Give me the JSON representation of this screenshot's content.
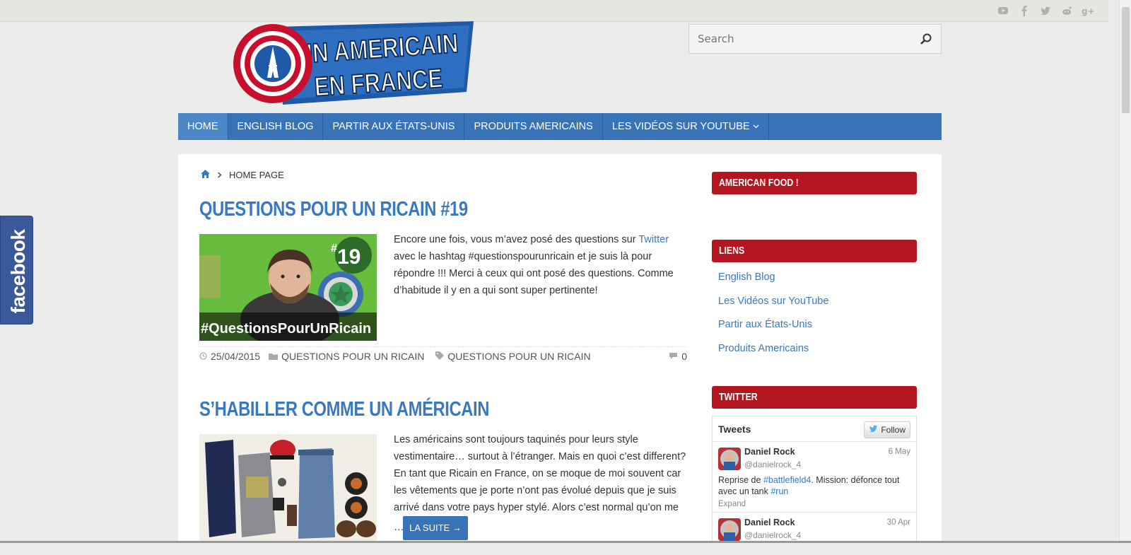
{
  "social": {
    "icons": [
      "youtube-icon",
      "facebook-icon",
      "twitter-icon",
      "reddit-icon",
      "google-plus-icon"
    ]
  },
  "logo": {
    "line1": "UN AMERICAIN",
    "line2": "EN FRANCE"
  },
  "search": {
    "placeholder": "Search"
  },
  "nav": {
    "items": [
      {
        "label": "HOME"
      },
      {
        "label": "ENGLISH BLOG"
      },
      {
        "label": "PARTIR AUX ÉTATS-UNIS"
      },
      {
        "label": "PRODUITS AMERICAINS"
      },
      {
        "label": "LES VIDÉOS SUR YOUTUBE"
      }
    ]
  },
  "breadcrumb": {
    "current": "HOME PAGE"
  },
  "posts": [
    {
      "title": "QUESTIONS POUR UN RICAIN #19",
      "thumb_badge_hash": "#",
      "thumb_badge_num": "19",
      "thumb_caption": "#QuestionsPourUnRicain",
      "text_before_link": "Encore une fois, vous m’avez posé des questions sur ",
      "link": "Twitter",
      "text_after_link": " avec le hashtag #questionspourunricain et je suis là pour répondre !!! Merci à ceux qui ont posé des questions. Comme d’habitude il y en a qui sont super pertinente!",
      "date": "25/04/2015",
      "category": "QUESTIONS POUR UN RICAIN",
      "tag": "QUESTIONS POUR UN RICAIN",
      "comments": "0"
    },
    {
      "title": "S’HABILLER COMME UN AMÉRICAIN",
      "text": "Les américains sont toujours taquinés pour leurs style vestimentaire… surtout à l’étranger. Mais en quoi c’est different? En tant que Ricain en France, on se moque de moi souvent car les vêtements que je porte n’ont pas évolué depuis que je suis arrivé dans votre pays hyper stylé. Alors c’est normal qu’on me",
      "ellipsis": "…",
      "readmore": "LA SUITE →"
    }
  ],
  "sidebar": {
    "widget1": {
      "title": "AMERICAN FOOD !"
    },
    "widget2": {
      "title": "LIENS",
      "links": [
        "English Blog",
        "Les Vidéos sur YouTube",
        "Partir aux États-Unis",
        "Produits Americains"
      ]
    },
    "widget3": {
      "title": "TWITTER",
      "header": "Tweets",
      "follow": "Follow",
      "tweets": [
        {
          "name": "Daniel Rock",
          "handle": "@danielrock_4",
          "date": "6 May",
          "text_a": "Reprise de ",
          "tag1": "#battlefield4",
          "text_b": ". Mission: défonce tout avec un tank ",
          "tag2": "#run",
          "expand": "Expand"
        },
        {
          "name": "Daniel Rock",
          "handle": "@danielrock_4",
          "date": "30 Apr"
        }
      ]
    }
  },
  "facebook_tab": {
    "label": "facebook"
  },
  "colors": {
    "nav": "#3873b8",
    "widget_title": "#b3161f",
    "link": "#3a78c0",
    "facebook": "#3b5998"
  }
}
